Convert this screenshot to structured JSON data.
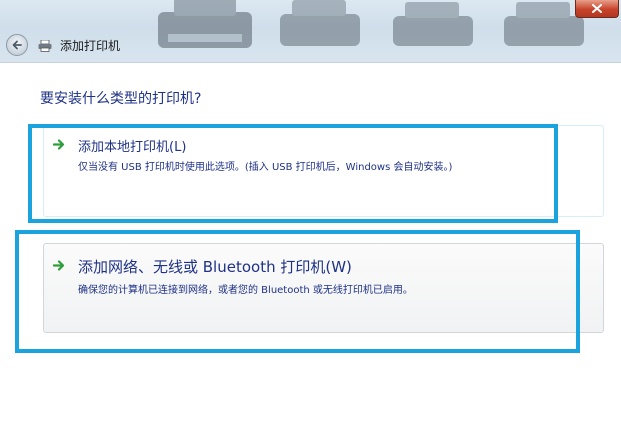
{
  "window": {
    "nav_title": "添加打印机",
    "close_symbol": "x"
  },
  "icons": {
    "back": "back-arrow-icon",
    "nav_printer": "printer-icon",
    "option_arrow": "green-arrow-icon",
    "close": "close-icon"
  },
  "main": {
    "question": "要安装什么类型的打印机?",
    "options": [
      {
        "title": "添加本地打印机(L)",
        "description": "仅当没有 USB 打印机时使用此选项。(插入 USB 打印机后，Windows 会自动安装。)",
        "highlighted": true
      },
      {
        "title": "添加网络、无线或 Bluetooth 打印机(W)",
        "description": "确保您的计算机已连接到网络，或者您的 Bluetooth 或无线打印机已启用。",
        "highlighted": true
      }
    ]
  },
  "colors": {
    "text_blue": "#1e3287",
    "highlight_cyan": "#1aa3dd",
    "arrow_green": "#2e9e3a",
    "close_red": "#c7432b"
  }
}
